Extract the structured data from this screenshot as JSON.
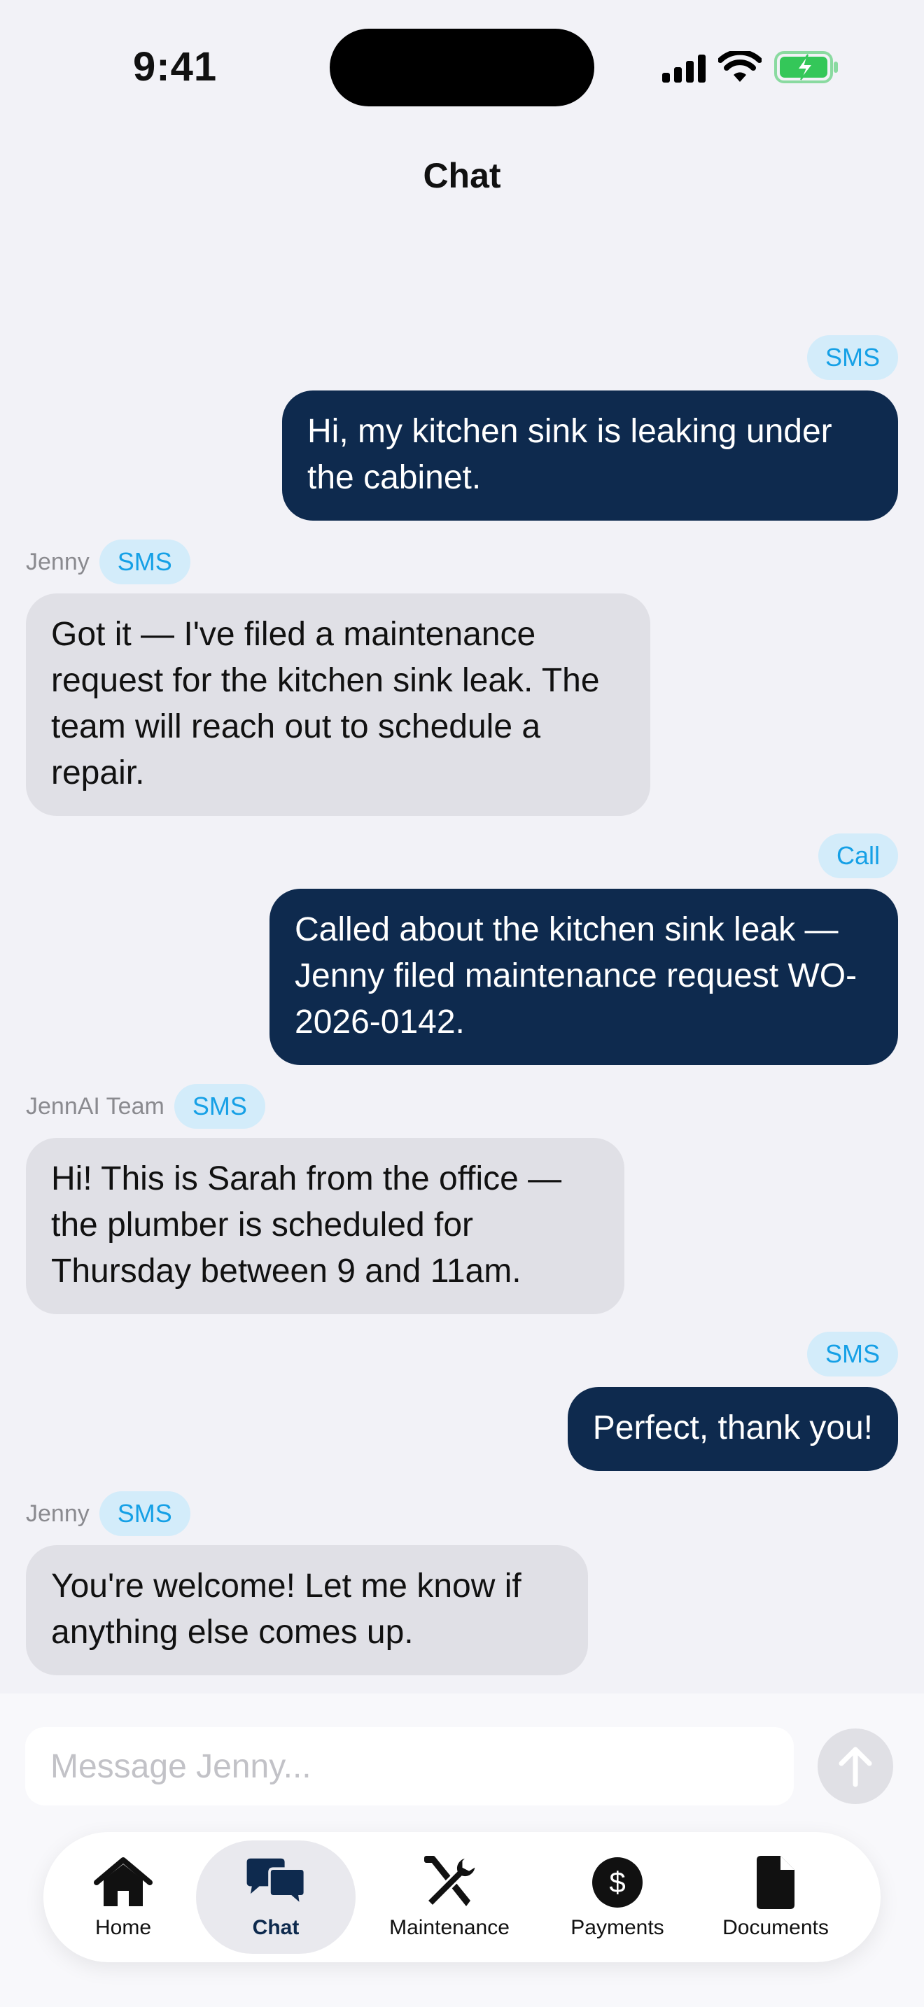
{
  "status_bar": {
    "time": "9:41"
  },
  "header": {
    "title": "Chat"
  },
  "messages": [
    {
      "direction": "out",
      "channel": "SMS",
      "sender": "",
      "text": "Hi, my kitchen sink is leaking under the cabinet."
    },
    {
      "direction": "in",
      "channel": "SMS",
      "sender": "Jenny",
      "text": "Got it — I've filed a maintenance request for the kitchen sink leak. The team will reach out to schedule a repair."
    },
    {
      "direction": "out",
      "channel": "Call",
      "sender": "",
      "text": "Called about the kitchen sink leak — Jenny filed maintenance request WO-2026-0142."
    },
    {
      "direction": "in",
      "channel": "SMS",
      "sender": "JennAI Team",
      "text": "Hi! This is Sarah from the office — the plumber is scheduled for Thursday between 9 and 11am."
    },
    {
      "direction": "out",
      "channel": "SMS",
      "sender": "",
      "text": "Perfect, thank you!"
    },
    {
      "direction": "in",
      "channel": "SMS",
      "sender": "Jenny",
      "text": "You're welcome! Let me know if anything else comes up."
    }
  ],
  "composer": {
    "placeholder": "Message Jenny...",
    "value": ""
  },
  "tabs": [
    {
      "label": "Home",
      "icon": "house-icon",
      "active": false
    },
    {
      "label": "Chat",
      "icon": "chat-bubbles-icon",
      "active": true
    },
    {
      "label": "Maintenance",
      "icon": "tools-icon",
      "active": false
    },
    {
      "label": "Payments",
      "icon": "dollar-circle-icon",
      "active": false
    },
    {
      "label": "Documents",
      "icon": "document-icon",
      "active": false
    }
  ],
  "colors": {
    "outgoing_bubble": "#0e2a4e",
    "incoming_bubble": "#e0e0e6",
    "badge_bg": "#d3ecfa",
    "badge_text": "#15a0e6",
    "battery": "#34c759"
  }
}
